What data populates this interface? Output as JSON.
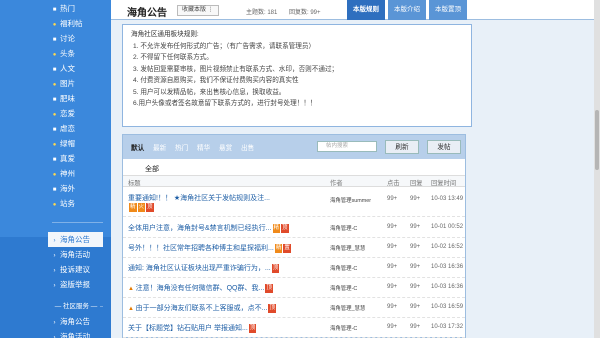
{
  "sidebar": {
    "items": [
      {
        "label": "热门",
        "dot": false
      },
      {
        "label": "福利帖",
        "dot": true
      },
      {
        "label": "讨论",
        "dot": false
      },
      {
        "label": "头条",
        "dot": true
      },
      {
        "label": "人文",
        "dot": false
      },
      {
        "label": "图片",
        "dot": true
      },
      {
        "label": "肥味",
        "dot": false
      },
      {
        "label": "恋爱",
        "dot": true
      },
      {
        "label": "虐恋",
        "dot": false
      },
      {
        "label": "绿帽",
        "dot": true
      },
      {
        "label": "真爱",
        "dot": false
      },
      {
        "label": "神州",
        "dot": true
      },
      {
        "label": "海外",
        "dot": false
      },
      {
        "label": "站务",
        "dot": true
      }
    ],
    "sub_items": [
      "海角公告",
      "海角活动",
      "投诉建议",
      "盗版举报"
    ],
    "service_label": "社区服务",
    "service_items": [
      "海角公告",
      "海角活动"
    ]
  },
  "topbar": {
    "title": "海角公告",
    "fav": "收藏本版 ⋮",
    "topics": "主题数: 181",
    "replies": "回复数: 99+",
    "tabs": [
      "本版规则",
      "本版介绍",
      "本版置顶"
    ]
  },
  "rules": {
    "title": "海角社区通用板块规则:",
    "lines": [
      "1. 不允许发布任何形式的广告；（有广告需求，请联系管理员）",
      "2. 不得留下任何联系方式。",
      "3. 发帖回复需要审核，图片视频禁止有联系方式、水印，否则不通过；",
      "4. 付费资源自愿购买，我们不保证付费购买内容的真实性",
      "5. 用户可以发精品帖，来出售核心信息，换取收益。",
      "6.用户头像或者签名故意留下联系方式的，进行封号处理！！！"
    ]
  },
  "threads": {
    "filter_tabs": [
      "默认",
      "最新",
      "热门",
      "精华",
      "悬赏",
      "出售"
    ],
    "search_placeholder": "帖内搜索",
    "refresh": "刷新",
    "post": "发帖",
    "all_label": "全部",
    "columns": {
      "title": "标题",
      "author": "作者",
      "views": "点击",
      "replies": "回复",
      "time": "回复时间"
    },
    "rows": [
      {
        "title": "重要通知!！！ ★海角社区关于发帖规则及注...",
        "tags": [
          [
            "精",
            "h"
          ],
          [
            "火",
            "h"
          ],
          [
            "顶",
            "d"
          ]
        ],
        "author": "海角管理summer",
        "views": "99+",
        "replies": "99+",
        "time": "10-03 13:49",
        "warn": false
      },
      {
        "title": "全体用户注意，海角封号&禁言机制已经执行...",
        "tags": [
          [
            "精",
            "h"
          ],
          [
            "顶",
            "d"
          ]
        ],
        "author": "海角管理-C",
        "views": "99+",
        "replies": "99+",
        "time": "10-01 00:52",
        "warn": false
      },
      {
        "title": "号外！！！社区常年招聘各种博主和星探福利...",
        "tags": [
          [
            "精",
            "h"
          ],
          [
            "置",
            "d"
          ]
        ],
        "author": "海角管理_慧慧",
        "views": "99+",
        "replies": "99+",
        "time": "10-02 16:52",
        "warn": false
      },
      {
        "title": "通知: 海角社区认证板块出现严重诈骗行为，...",
        "tags": [
          [
            "顶",
            "d"
          ]
        ],
        "author": "海角管理-C",
        "views": "99+",
        "replies": "99+",
        "time": "10-03 16:36",
        "warn": false
      },
      {
        "title": "注意！海角没有任何微信群、QQ群、我...",
        "tags": [
          [
            "顶",
            "d"
          ]
        ],
        "author": "海角管理-C",
        "views": "99+",
        "replies": "99+",
        "time": "10-03 16:36",
        "warn": true
      },
      {
        "title": "由于一部分海友们联系不上客服或，点不...",
        "tags": [
          [
            "顶",
            "d"
          ]
        ],
        "author": "海角管理_慧慧",
        "views": "99+",
        "replies": "99+",
        "time": "10-03 16:59",
        "warn": true
      },
      {
        "title": "关于【标题党】钻石贴用户 举报通知...",
        "tags": [
          [
            "顶",
            "d"
          ]
        ],
        "author": "海角管理-C",
        "views": "99+",
        "replies": "99+",
        "time": "10-03 17:32",
        "warn": false
      }
    ]
  }
}
